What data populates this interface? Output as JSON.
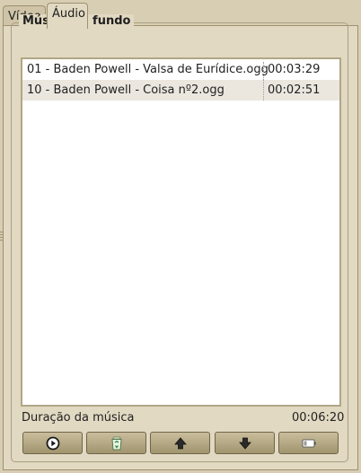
{
  "tabs": [
    {
      "label": "Vídeo",
      "active": false
    },
    {
      "label": "Áudio",
      "active": true
    }
  ],
  "group": {
    "title": "Música de fundo"
  },
  "tracks": [
    {
      "name": "01 - Baden Powell - Valsa de Eurídice.ogg",
      "duration": "00:03:29"
    },
    {
      "name": "10 - Baden Powell - Coisa nº2.ogg",
      "duration": "00:02:51"
    }
  ],
  "summary": {
    "label": "Duração da música",
    "value": "00:06:20"
  },
  "buttons": [
    {
      "icon": "play-icon"
    },
    {
      "icon": "recycle-bin-icon"
    },
    {
      "icon": "arrow-up-icon"
    },
    {
      "icon": "arrow-down-icon"
    },
    {
      "icon": "battery-icon"
    }
  ],
  "colors": {
    "background": "#d8ceb3",
    "panel": "#e2d9c2",
    "list": "#ffffff",
    "alt_row": "#ebe7df"
  }
}
